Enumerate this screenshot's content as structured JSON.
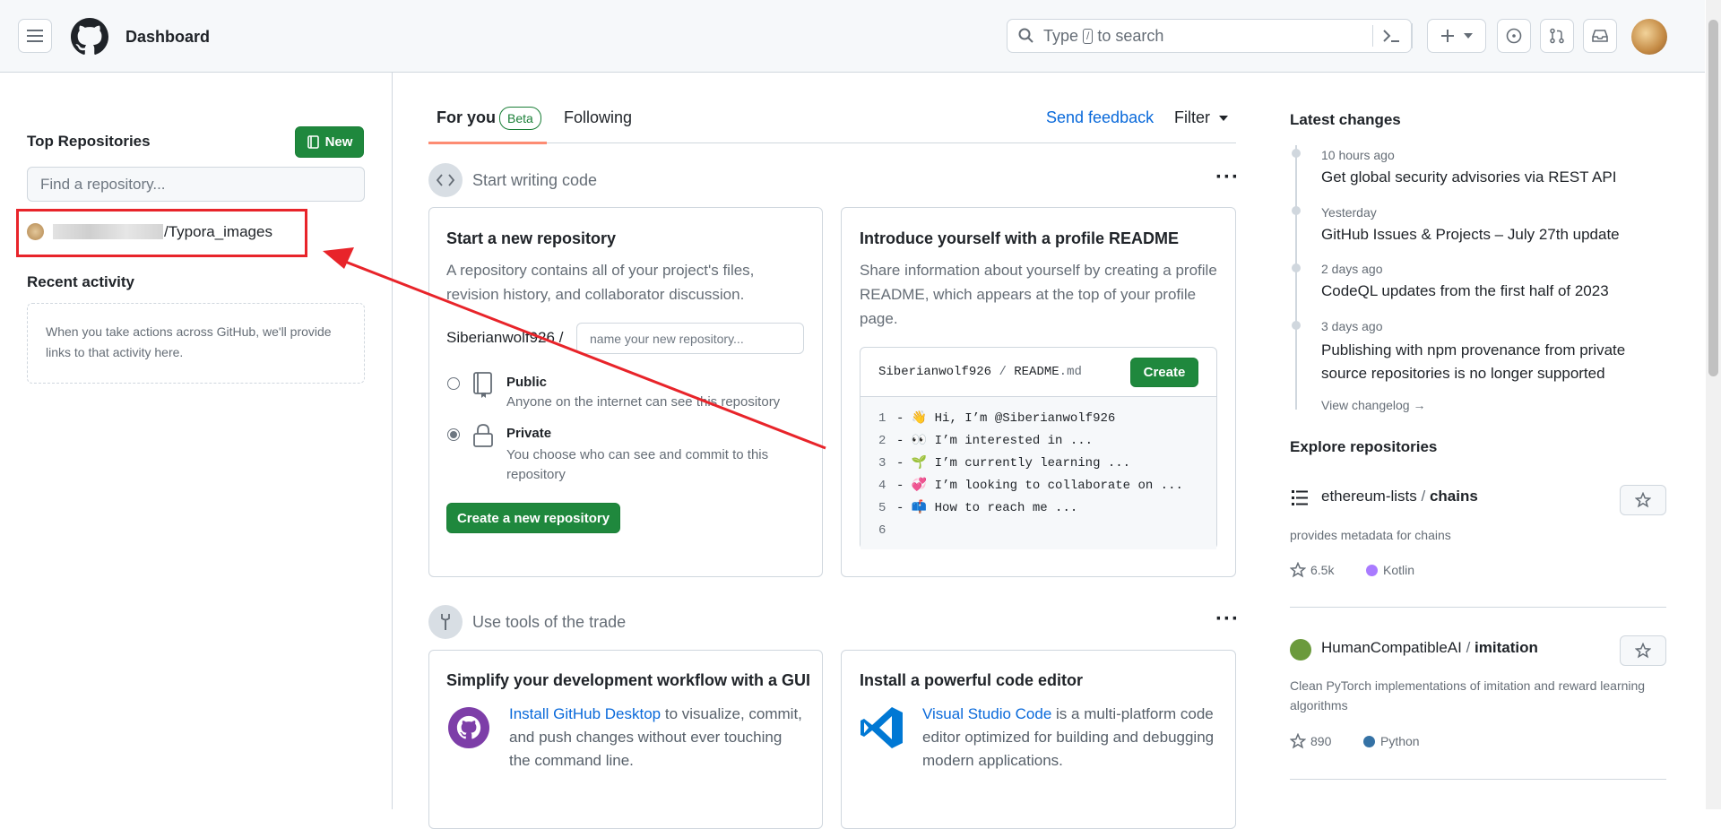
{
  "header": {
    "title": "Dashboard",
    "search_placeholder_pre": "Type",
    "search_key": "/",
    "search_placeholder_post": "to search"
  },
  "sidebar": {
    "top_repos_title": "Top Repositories",
    "new_button": "New",
    "find_placeholder": "Find a repository...",
    "repo_name": "/Typora_images",
    "recent_activity_title": "Recent activity",
    "recent_activity_text": "When you take actions across GitHub, we'll provide links to that activity here."
  },
  "feed": {
    "tabs": [
      {
        "label": "For you",
        "badge": "Beta"
      },
      {
        "label": "Following"
      }
    ],
    "send_feedback": "Send feedback",
    "filter": "Filter",
    "section1_title": "Start writing code",
    "section2_title": "Use tools of the trade",
    "new_repo_card": {
      "title": "Start a new repository",
      "desc": "A repository contains all of your project's files, revision history, and collaborator discussion.",
      "owner": "Siberianwolf926 /",
      "name_placeholder": "name your new repository...",
      "public_label": "Public",
      "public_desc": "Anyone on the internet can see this repository",
      "private_label": "Private",
      "private_desc": "You choose who can see and commit to this repository",
      "create_button": "Create a new repository"
    },
    "readme_card": {
      "title": "Introduce yourself with a profile README",
      "desc": "Share information about yourself by creating a profile README, which appears at the top of your profile page.",
      "file_owner": "Siberianwolf926",
      "file_sep": "/",
      "file_name": "README",
      "file_ext": ".md",
      "create_button": "Create",
      "lines": [
        {
          "num": "1",
          "text": "- 👋 Hi, I’m @Siberianwolf926"
        },
        {
          "num": "2",
          "text": "- 👀 I’m interested in ..."
        },
        {
          "num": "3",
          "text": "- 🌱 I’m currently learning ..."
        },
        {
          "num": "4",
          "text": "- 💞️ I’m looking to collaborate on ..."
        },
        {
          "num": "5",
          "text": "- 📫 How to reach me ..."
        },
        {
          "num": "6",
          "text": ""
        }
      ]
    },
    "desktop_card": {
      "title": "Simplify your development workflow with a GUI",
      "link": "Install GitHub Desktop",
      "text": " to visualize, commit, and push changes without ever touching the command line."
    },
    "editor_card": {
      "title": "Install a powerful code editor",
      "link": "Visual Studio Code",
      "text": " is a multi-platform code editor optimized for building and debugging modern applications."
    }
  },
  "right": {
    "latest_title": "Latest changes",
    "changes": [
      {
        "time": "10 hours ago",
        "text": "Get global security advisories via REST API"
      },
      {
        "time": "Yesterday",
        "text": "GitHub Issues & Projects – July 27th update"
      },
      {
        "time": "2 days ago",
        "text": "CodeQL updates from the first half of 2023"
      },
      {
        "time": "3 days ago",
        "text": "Publishing with npm provenance from private source repositories is no longer supported"
      }
    ],
    "view_changelog": "View changelog →",
    "explore_title": "Explore repositories",
    "repos": [
      {
        "owner": "ethereum-lists",
        "sep": " / ",
        "name": "chains",
        "desc": "provides metadata for chains",
        "stars": "6.5k",
        "lang": "Kotlin",
        "lang_color": "#A97BFF"
      },
      {
        "owner": "HumanCompatibleAI",
        "sep": " / ",
        "name": "imitation",
        "desc": "Clean PyTorch implementations of imitation and reward learning algorithms",
        "stars": "890",
        "lang": "Python",
        "lang_color": "#3572A5"
      }
    ]
  },
  "colors": {
    "accent_green": "#1f883d",
    "link_blue": "#0969da",
    "annotation_red": "#e8242a"
  }
}
